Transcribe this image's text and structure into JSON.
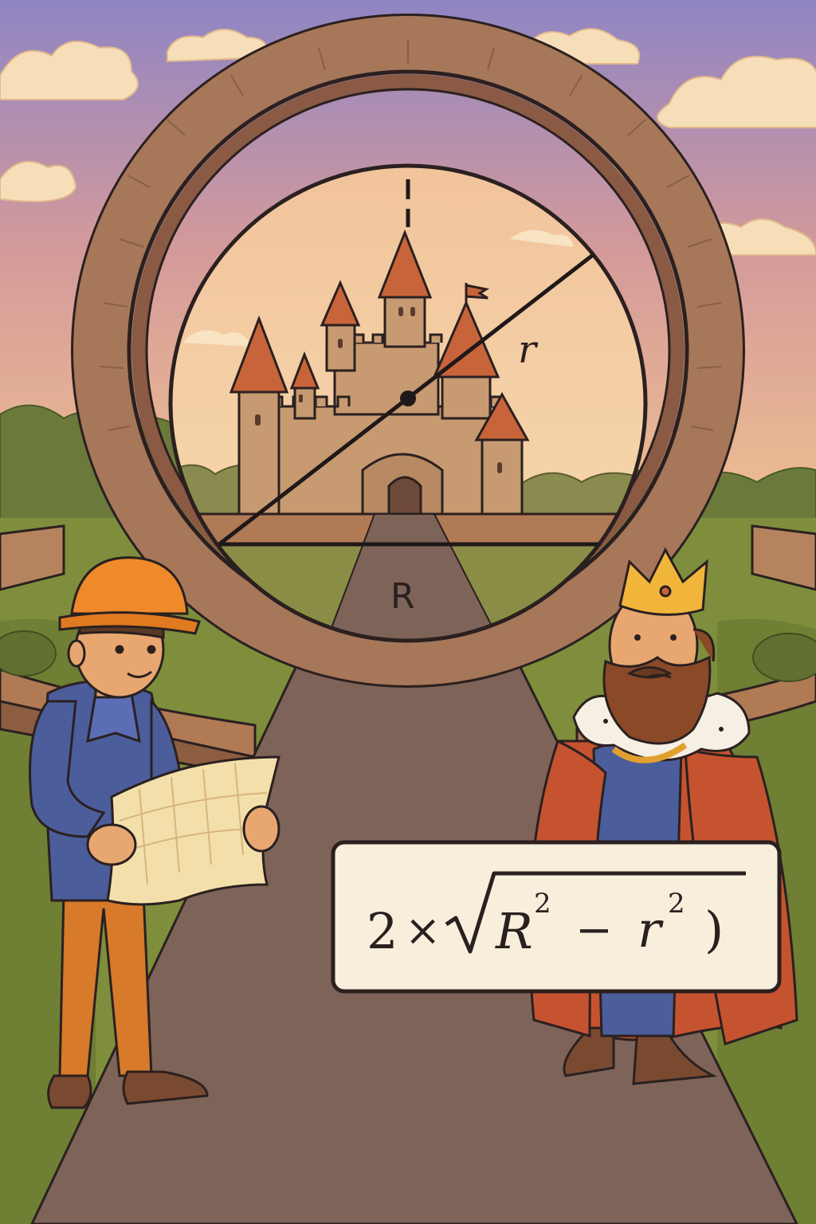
{
  "labels": {
    "small_radius": "r",
    "large_radius": "R"
  },
  "formula": {
    "coefficient": "2",
    "times": "×",
    "radical": "√",
    "big_r": "R",
    "big_r_exp": "2",
    "minus": "−",
    "small_r": "r",
    "small_r_exp": "2",
    "close_paren": ")"
  },
  "colors": {
    "sky_top": "#8f85c4",
    "sky_bottom": "#f3c58f",
    "stone": "#a7775a",
    "outline": "#2b2020",
    "grass": "#7e8e3c",
    "path": "#7d6358",
    "castle": "#c79a72",
    "roof": "#c8643a",
    "hardhat": "#ef8a2a",
    "jacket": "#4b5d9a",
    "crown": "#f0b53a",
    "robe": "#c5532f"
  }
}
